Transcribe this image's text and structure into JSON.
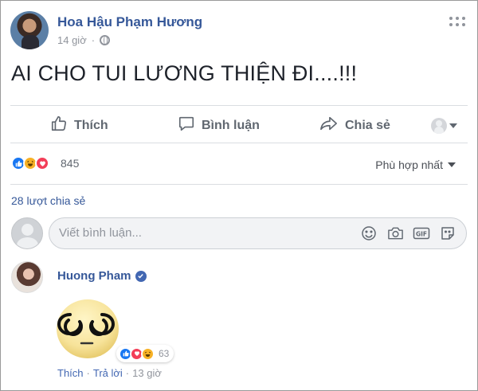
{
  "post": {
    "author": "Hoa Hậu Phạm Hương",
    "time": "14 giờ",
    "privacy_icon": "globe-icon",
    "text": "AI CHO TUI LƯƠNG THIỆN ĐI....!!!"
  },
  "actions": {
    "like_label": "Thích",
    "comment_label": "Bình luận",
    "share_label": "Chia sẻ"
  },
  "reactions": {
    "types": [
      "like",
      "haha",
      "love"
    ],
    "count": "845"
  },
  "sort": {
    "label": "Phù hợp nhất"
  },
  "shares": {
    "label": "28 lượt chia sẻ"
  },
  "composer": {
    "placeholder": "Viết bình luận...",
    "icons": [
      "emoji-icon",
      "camera-icon",
      "gif-icon",
      "sticker-icon"
    ]
  },
  "comment": {
    "author": "Huong Pham",
    "verified": true,
    "reaction_types": [
      "like",
      "love",
      "haha"
    ],
    "reaction_count": "63",
    "like_label": "Thích",
    "separator": "·",
    "reply_label": "Trả lời",
    "time": "13 giờ"
  },
  "colors": {
    "link_blue": "#365899",
    "like_blue": "#1877f2",
    "love_red": "#f33e58",
    "haha_yellow": "#f7b125"
  }
}
